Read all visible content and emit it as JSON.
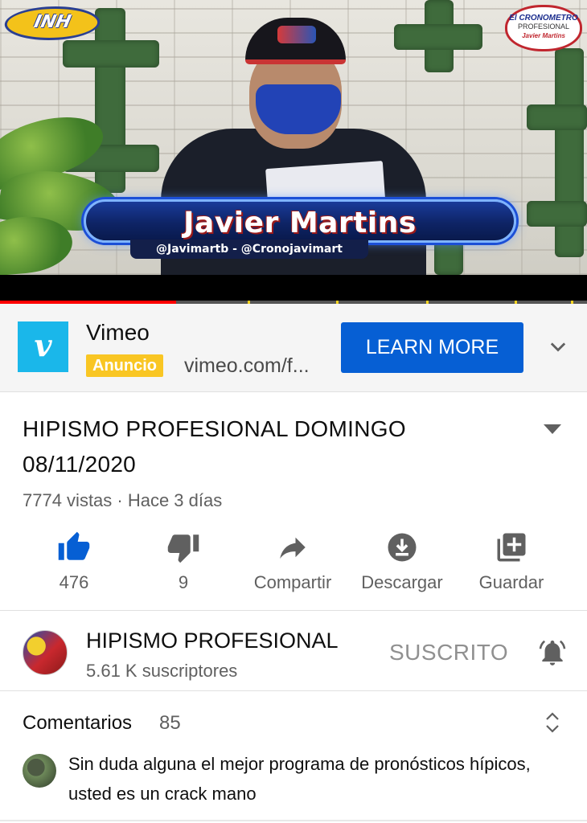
{
  "video": {
    "overlay_name": "Javier Martins",
    "overlay_handles": "@Javimartb - @Cronojavimart",
    "logo_left_text": "INH",
    "logo_right_line1": "El CRONOMETRO",
    "logo_right_line2": "PROFESIONAL",
    "logo_right_line3": "Javier Martins",
    "progress_fraction": 0.3
  },
  "ad": {
    "brand": "Vimeo",
    "badge": "Anuncio",
    "url": "vimeo.com/f...",
    "cta": "LEARN MORE",
    "logo_glyph": "v",
    "accent_color": "#065fd4",
    "logo_color": "#1ab7ea"
  },
  "video_info": {
    "title": "HIPISMO PROFESIONAL  DOMINGO 08/11/2020",
    "meta": "7774 vistas · Hace 3 días"
  },
  "actions": [
    {
      "icon": "thumbs-up-icon",
      "label": "476"
    },
    {
      "icon": "thumbs-down-icon",
      "label": "9"
    },
    {
      "icon": "share-icon",
      "label": "Compartir"
    },
    {
      "icon": "download-icon",
      "label": "Descargar"
    },
    {
      "icon": "save-icon",
      "label": "Guardar"
    }
  ],
  "channel": {
    "name": "HIPISMO PROFESIONAL",
    "subscribers": "5.61 K suscriptores",
    "subscribe_state": "SUSCRITO"
  },
  "comments": {
    "header": "Comentarios",
    "count": "85",
    "first_comment": "Sin duda alguna el mejor programa de pronósticos hípicos, usted es un crack mano"
  }
}
